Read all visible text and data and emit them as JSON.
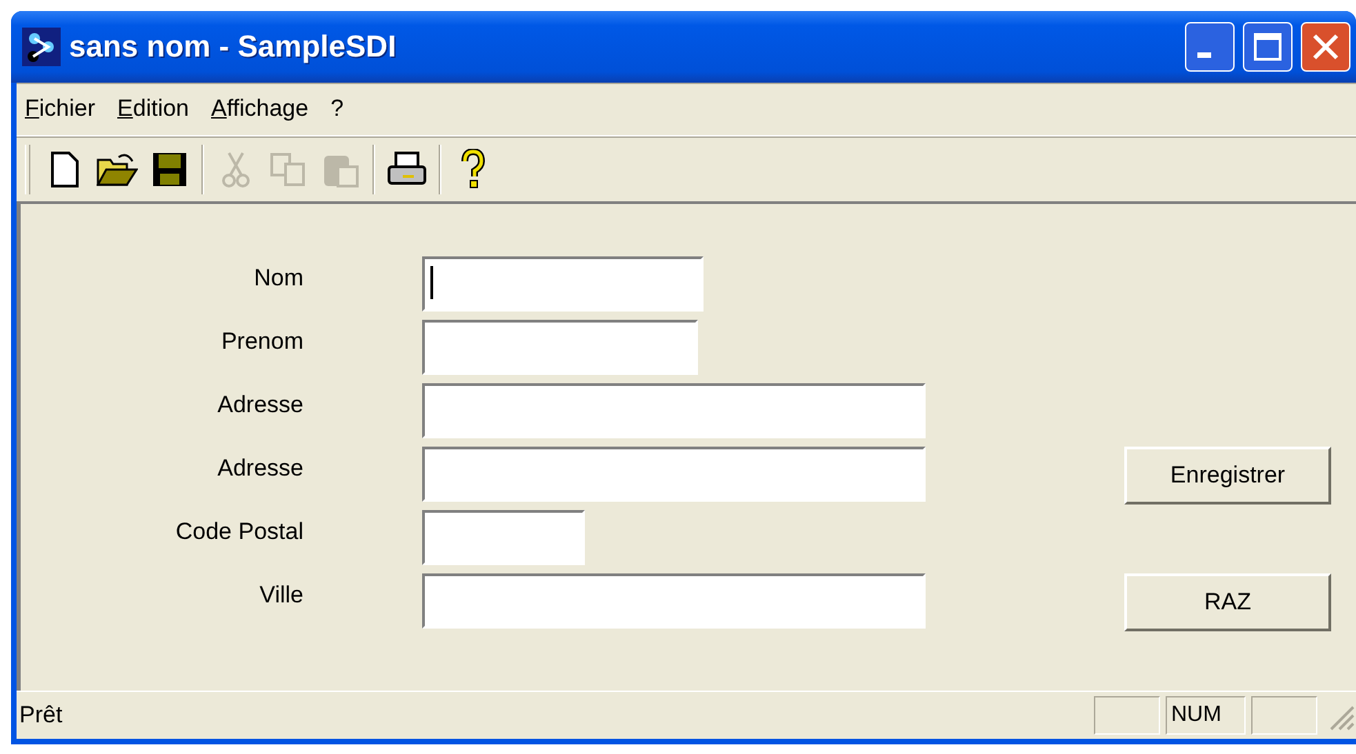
{
  "window": {
    "title": "sans nom - SampleSDI"
  },
  "menu": [
    {
      "label": "Fichier"
    },
    {
      "label": "Edition"
    },
    {
      "label": "Affichage"
    },
    {
      "label": "?"
    }
  ],
  "toolbar": [
    {
      "kind": "new",
      "disabled": false
    },
    {
      "kind": "open",
      "disabled": false
    },
    {
      "kind": "save",
      "disabled": false
    },
    {
      "kind": "separator"
    },
    {
      "kind": "cut",
      "disabled": true
    },
    {
      "kind": "copy",
      "disabled": true
    },
    {
      "kind": "paste",
      "disabled": true
    },
    {
      "kind": "separator"
    },
    {
      "kind": "print",
      "disabled": false
    },
    {
      "kind": "separator"
    },
    {
      "kind": "help",
      "disabled": false
    }
  ],
  "form": {
    "fields": [
      {
        "label": "Nom",
        "focused": true
      },
      {
        "label": "Prenom",
        "focused": false
      },
      {
        "label": "Adresse",
        "focused": false
      },
      {
        "label": "Adresse",
        "focused": false
      },
      {
        "label": "Code Postal",
        "focused": false
      },
      {
        "label": "Ville",
        "focused": false
      }
    ],
    "buttons": [
      "Enregistrer",
      "RAZ"
    ]
  },
  "status_bar": {
    "text": "Prêt",
    "panes": [
      {
        "text": "NUM"
      }
    ]
  }
}
